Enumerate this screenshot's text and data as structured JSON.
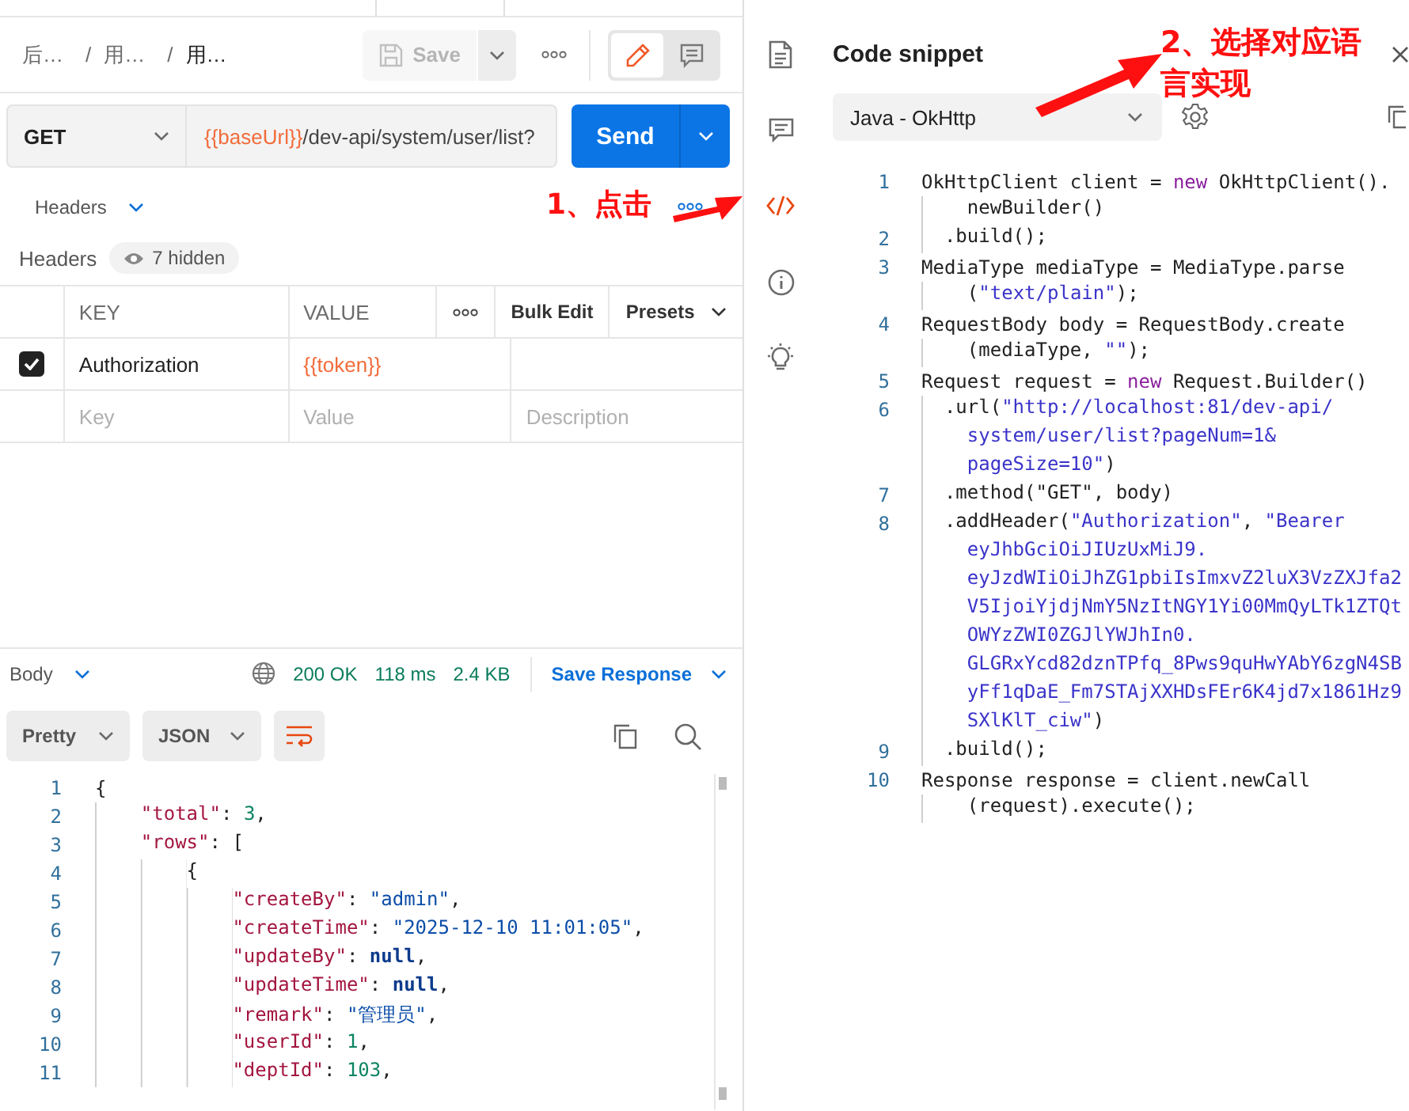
{
  "breadcrumb": [
    {
      "text": "后…",
      "current": false
    },
    {
      "separator": "/",
      "text": "用…",
      "current": false
    },
    {
      "separator": "/",
      "text": "用…",
      "current": true
    }
  ],
  "save_button": {
    "label": "Save",
    "disabled": true
  },
  "mode_toggle": [
    {
      "kind": "edit",
      "selected": true
    },
    {
      "kind": "comments",
      "selected": false
    }
  ],
  "request": {
    "method": "GET",
    "url_variable": "{{baseUrl}}",
    "url_path": "/dev-api/system/user/list?",
    "send": "Send"
  },
  "headers_section": {
    "dropdown": "Headers",
    "title": "Headers",
    "hidden_badge": "7 hidden"
  },
  "headers_table": {
    "columns": [
      "KEY",
      "VALUE"
    ],
    "bulk_edit": "Bulk Edit",
    "presets": "Presets",
    "rows": [
      {
        "checked": true,
        "key": "Authorization",
        "value": "{{token}}"
      }
    ],
    "new_row": {
      "key_placeholder": "Key",
      "value_placeholder": "Value",
      "description_placeholder": "Description"
    }
  },
  "response": {
    "body_tab": "Body",
    "status": "200 OK",
    "time": "118 ms",
    "size": "2.4 KB",
    "save_response": "Save Response",
    "format": "Pretty",
    "language": "JSON",
    "wrap_lines": true,
    "lines": [
      {
        "number": "1",
        "parts": [
          {
            "kind": "punct",
            "text": "{"
          }
        ]
      },
      {
        "number": "2",
        "parts": [
          {
            "kind": "key",
            "text": "    \"total\""
          },
          {
            "kind": "punct",
            "text": ": "
          },
          {
            "kind": "number",
            "text": "3"
          },
          {
            "kind": "punct",
            "text": ","
          }
        ]
      },
      {
        "number": "3",
        "parts": [
          {
            "kind": "key",
            "text": "    \"rows\""
          },
          {
            "kind": "punct",
            "text": ": ["
          }
        ]
      },
      {
        "number": "4",
        "parts": [
          {
            "kind": "punct",
            "text": "        {"
          }
        ]
      },
      {
        "number": "5",
        "parts": [
          {
            "kind": "key",
            "text": "            \"createBy\""
          },
          {
            "kind": "punct",
            "text": ": "
          },
          {
            "kind": "string",
            "text": "\"admin\""
          },
          {
            "kind": "punct",
            "text": ","
          }
        ]
      },
      {
        "number": "6",
        "parts": [
          {
            "kind": "key",
            "text": "            \"createTime\""
          },
          {
            "kind": "punct",
            "text": ": "
          },
          {
            "kind": "string",
            "text": "\"2025-12-10 11:01:05\""
          },
          {
            "kind": "punct",
            "text": ","
          }
        ]
      },
      {
        "number": "7",
        "parts": [
          {
            "kind": "key",
            "text": "            \"updateBy\""
          },
          {
            "kind": "punct",
            "text": ": "
          },
          {
            "kind": "null",
            "text": "null"
          },
          {
            "kind": "punct",
            "text": ","
          }
        ]
      },
      {
        "number": "8",
        "parts": [
          {
            "kind": "key",
            "text": "            \"updateTime\""
          },
          {
            "kind": "punct",
            "text": ": "
          },
          {
            "kind": "null",
            "text": "null"
          },
          {
            "kind": "punct",
            "text": ","
          }
        ]
      },
      {
        "number": "9",
        "parts": [
          {
            "kind": "key",
            "text": "            \"remark\""
          },
          {
            "kind": "punct",
            "text": ": "
          },
          {
            "kind": "string",
            "text": "\"管理员\""
          },
          {
            "kind": "punct",
            "text": ","
          }
        ]
      },
      {
        "number": "10",
        "parts": [
          {
            "kind": "key",
            "text": "            \"userId\""
          },
          {
            "kind": "punct",
            "text": ": "
          },
          {
            "kind": "number",
            "text": "1"
          },
          {
            "kind": "punct",
            "text": ","
          }
        ]
      },
      {
        "number": "11",
        "parts": [
          {
            "kind": "key",
            "text": "            \"deptId\""
          },
          {
            "kind": "punct",
            "text": ": "
          },
          {
            "kind": "number",
            "text": "103"
          },
          {
            "kind": "punct",
            "text": ","
          }
        ]
      }
    ]
  },
  "side_rail": [
    {
      "kind": "documentation",
      "selected": false
    },
    {
      "kind": "comments",
      "selected": false
    },
    {
      "kind": "code",
      "selected": true
    },
    {
      "kind": "info",
      "selected": false
    },
    {
      "kind": "bulb",
      "selected": false
    }
  ],
  "code_snippet": {
    "title": "Code snippet",
    "language": "Java - OkHttp",
    "lines": [
      {
        "number": "1",
        "rows": [
          [
            {
              "kind": "plain",
              "text": "OkHttpClient client = "
            },
            {
              "kind": "keyword",
              "text": "new"
            },
            {
              "kind": "plain",
              "text": " OkHttpClient()."
            }
          ],
          [
            {
              "kind": "plain",
              "text": "    newBuilder()"
            }
          ]
        ]
      },
      {
        "number": "2",
        "rows": [
          [
            {
              "kind": "plain",
              "text": "  .build();"
            }
          ]
        ]
      },
      {
        "number": "3",
        "rows": [
          [
            {
              "kind": "plain",
              "text": "MediaType mediaType = MediaType.parse"
            }
          ],
          [
            {
              "kind": "plain",
              "text": "    ("
            },
            {
              "kind": "string",
              "text": "\"text/plain\""
            },
            {
              "kind": "plain",
              "text": ");"
            }
          ]
        ]
      },
      {
        "number": "4",
        "rows": [
          [
            {
              "kind": "plain",
              "text": "RequestBody body = RequestBody.create"
            }
          ],
          [
            {
              "kind": "plain",
              "text": "    (mediaType, "
            },
            {
              "kind": "string",
              "text": "\"\""
            },
            {
              "kind": "plain",
              "text": ");"
            }
          ]
        ]
      },
      {
        "number": "5",
        "rows": [
          [
            {
              "kind": "plain",
              "text": "Request request = "
            },
            {
              "kind": "keyword",
              "text": "new"
            },
            {
              "kind": "plain",
              "text": " Request.Builder()"
            }
          ]
        ]
      },
      {
        "number": "6",
        "rows": [
          [
            {
              "kind": "plain",
              "text": "  .url("
            },
            {
              "kind": "string",
              "text": "\"http://localhost:81/dev-api/"
            }
          ],
          [
            {
              "kind": "string",
              "text": "    system/user/list?pageNum=1&"
            }
          ],
          [
            {
              "kind": "string",
              "text": "    pageSize=10\""
            },
            {
              "kind": "plain",
              "text": ")"
            }
          ]
        ]
      },
      {
        "number": "7",
        "rows": [
          [
            {
              "kind": "plain",
              "text": "  .method(\"GET\", body)"
            }
          ]
        ]
      },
      {
        "number": "8",
        "rows": [
          [
            {
              "kind": "plain",
              "text": "  .addHeader("
            },
            {
              "kind": "string",
              "text": "\"Authorization\""
            },
            {
              "kind": "plain",
              "text": ", "
            },
            {
              "kind": "string",
              "text": "\"Bearer"
            }
          ],
          [
            {
              "kind": "string",
              "text": "    eyJhbGciOiJIUzUxMiJ9."
            }
          ],
          [
            {
              "kind": "string",
              "text": "    eyJzdWIiOiJhZG1pbiIsImxvZ2luX3VzZXJfa2"
            }
          ],
          [
            {
              "kind": "string",
              "text": "    V5IjoiYjdjNmY5NzItNGY1Yi00MmQyLTk1ZTQt"
            }
          ],
          [
            {
              "kind": "string",
              "text": "    OWYzZWI0ZGJlYWJhIn0."
            }
          ],
          [
            {
              "kind": "string",
              "text": "    GLGRxYcd82dznTPfq_8Pws9quHwYAbY6zgN4SB"
            }
          ],
          [
            {
              "kind": "string",
              "text": "    yFf1qDaE_Fm7STAjXXHDsFEr6K4jd7x1861Hz9"
            }
          ],
          [
            {
              "kind": "string",
              "text": "    SXlKlT_ciw\""
            },
            {
              "kind": "plain",
              "text": ")"
            }
          ]
        ]
      },
      {
        "number": "9",
        "rows": [
          [
            {
              "kind": "plain",
              "text": "  .build();"
            }
          ]
        ]
      },
      {
        "number": "10",
        "rows": [
          [
            {
              "kind": "plain",
              "text": "Response response = client.newCall"
            }
          ],
          [
            {
              "kind": "plain",
              "text": "    (request).execute();"
            }
          ]
        ]
      }
    ]
  },
  "annotations": [
    {
      "text": "1、点击"
    },
    {
      "text": "2、选择对应语言实现"
    }
  ]
}
